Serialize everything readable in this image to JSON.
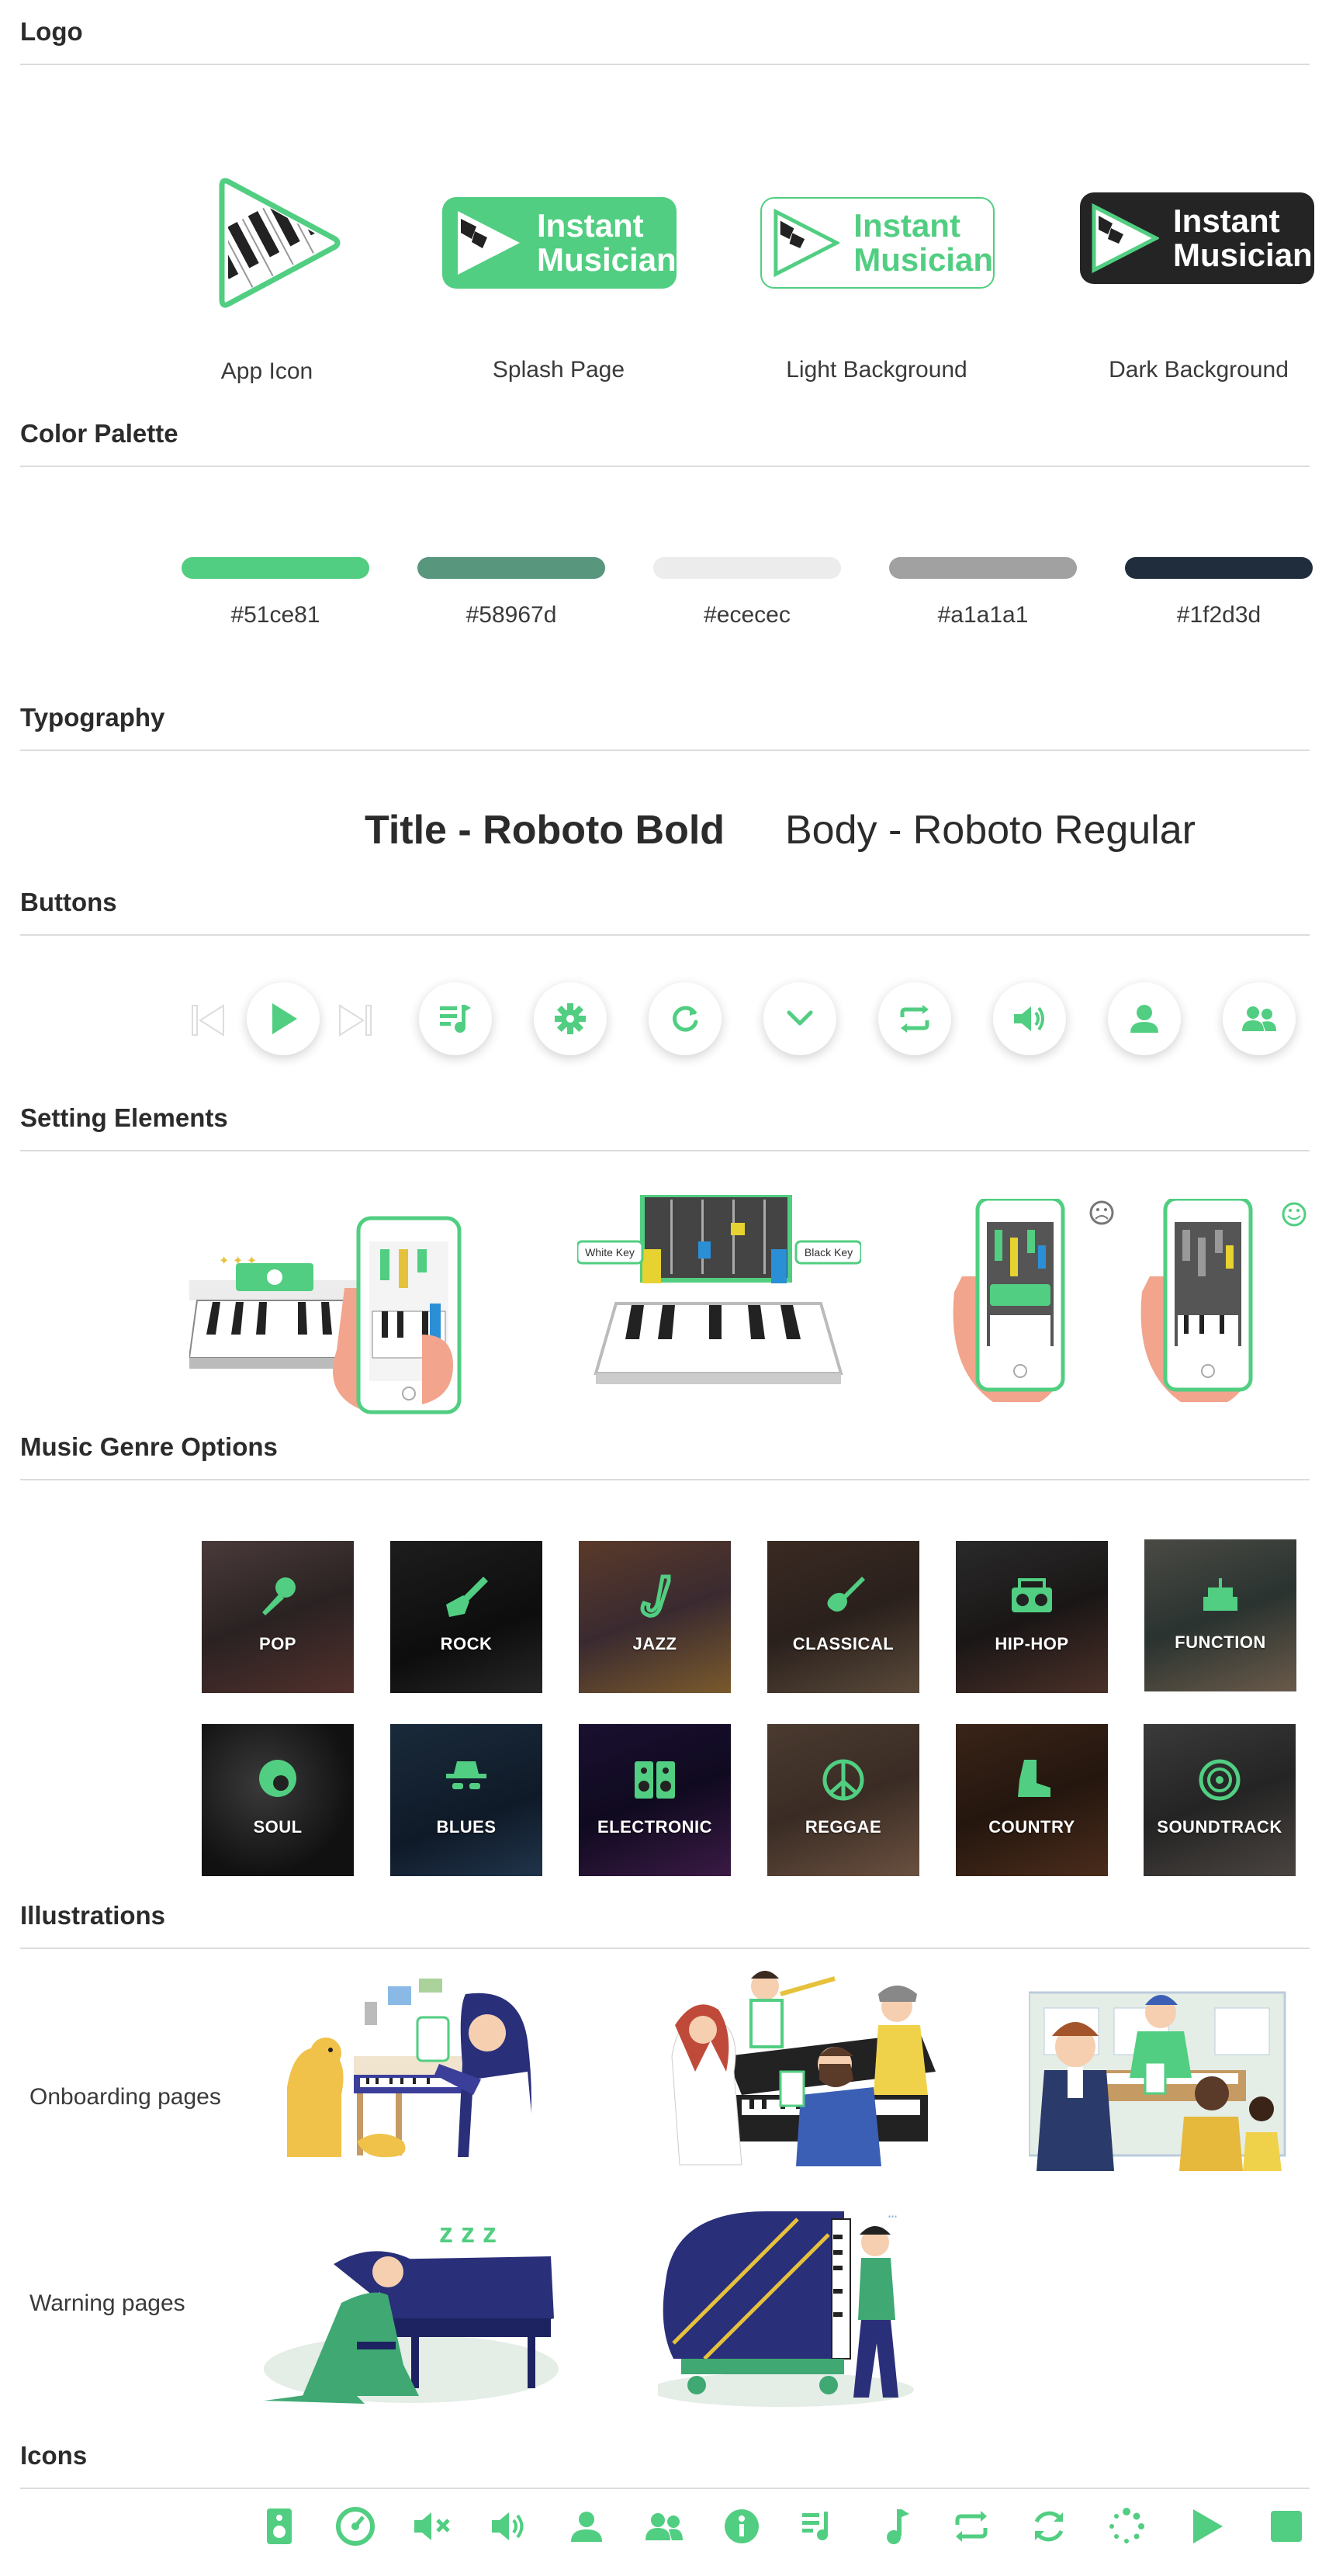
{
  "sections": {
    "logo": "Logo",
    "color_palette": "Color Palette",
    "typography": "Typography",
    "buttons": "Buttons",
    "setting_elements": "Setting Elements",
    "music_genre_options": "Music Genre Options",
    "illustrations": "Illustrations",
    "icons": "Icons"
  },
  "logo": {
    "brand_line1": "Instant",
    "brand_line2": "Musician",
    "captions": [
      "App Icon",
      "Splash Page",
      "Light Background",
      "Dark Background"
    ]
  },
  "palette": {
    "colors": [
      "#51ce81",
      "#58967d",
      "#ececec",
      "#a1a1a1",
      "#1f2d3d"
    ],
    "labels": [
      "#51ce81",
      "#58967d",
      "#ececec",
      "#a1a1a1",
      "#1f2d3d"
    ]
  },
  "typography": {
    "title_sample": "Title - Roboto Bold",
    "body_sample": "Body - Roboto Regular"
  },
  "setting_elements": {
    "white_key": "White Key",
    "black_key": "Black Key"
  },
  "genres": [
    "POP",
    "ROCK",
    "JAZZ",
    "CLASSICAL",
    "HIP-HOP",
    "FUNCTION",
    "SOUL",
    "BLUES",
    "ELECTRONIC",
    "REGGAE",
    "COUNTRY",
    "SOUNDTRACK"
  ],
  "illustrations": {
    "onboarding": "Onboarding pages",
    "warning": "Warning pages"
  },
  "theme": {
    "accent": "#51ce81",
    "dark": "#1f2d3d"
  }
}
